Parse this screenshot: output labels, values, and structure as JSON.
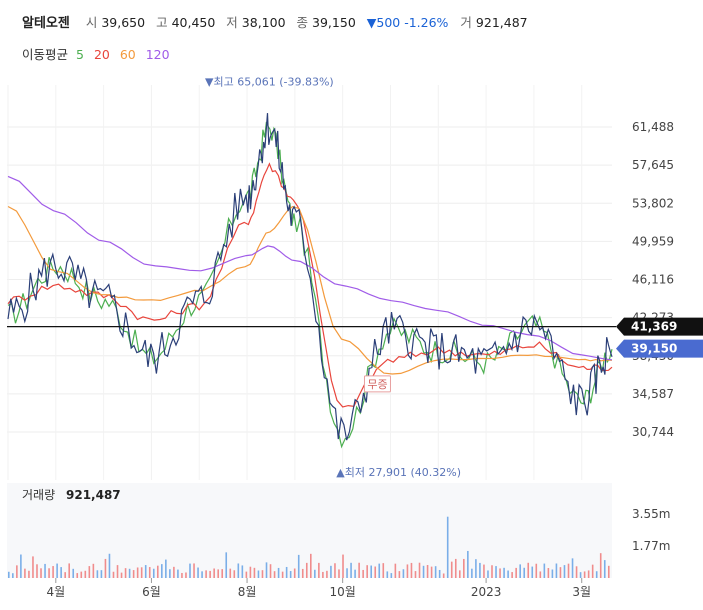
{
  "header": {
    "name": "알테오젠",
    "open_label": "시",
    "open": "39,650",
    "high_label": "고",
    "high": "40,450",
    "low_label": "저",
    "low": "38,100",
    "close_label": "종",
    "close": "39,150",
    "change_text": "▼500 -1.26%",
    "volume_label": "거",
    "volume": "921,487"
  },
  "ma_legend": {
    "title": "이동평균",
    "periods": [
      {
        "label": "5",
        "color": "#4caf50"
      },
      {
        "label": "20",
        "color": "#e8453c"
      },
      {
        "label": "60",
        "color": "#f39a3c"
      },
      {
        "label": "120",
        "color": "#a05ce8"
      }
    ]
  },
  "colors": {
    "price": "#2b3f78",
    "ma5": "#4caf50",
    "ma20": "#e8453c",
    "ma60": "#f39a3c",
    "ma120": "#a05ce8",
    "vol_up": "#f08c8c",
    "vol_down": "#7aaee8",
    "tag_current": "#4a6bd0",
    "tag_ref": "#111111"
  },
  "chart_data": [
    {
      "type": "line",
      "x": [
        "2022-03",
        "2022-04",
        "2022-05",
        "2022-06",
        "2022-07",
        "2022-08",
        "2022-08-15",
        "2022-09",
        "2022-10",
        "2022-11",
        "2022-12",
        "2023-01",
        "2023-02",
        "2023-03",
        "2023-03-20"
      ],
      "series": [
        {
          "name": "5",
          "values": [
            42500,
            47500,
            44000,
            38200,
            44000,
            54500,
            61500,
            52000,
            30500,
            41000,
            39000,
            37800,
            41500,
            33800,
            39150
          ]
        },
        {
          "name": "20",
          "values": [
            44000,
            45500,
            44500,
            42000,
            43500,
            52000,
            57500,
            54000,
            33000,
            38000,
            39000,
            38500,
            39500,
            37200,
            37300
          ]
        },
        {
          "name": "60",
          "values": [
            53500,
            47000,
            44500,
            44000,
            45000,
            47500,
            51000,
            53500,
            40000,
            36500,
            38000,
            38200,
            38500,
            38000,
            38000
          ]
        },
        {
          "name": "120",
          "values": [
            56500,
            53000,
            50000,
            47500,
            47000,
            48500,
            49500,
            48000,
            45500,
            44000,
            43000,
            41500,
            40500,
            38500,
            38000
          ]
        }
      ],
      "y_ticks": [
        "61,488",
        "57,645",
        "53,802",
        "49,959",
        "46,116",
        "42,273",
        "38,430",
        "34,587",
        "30,744"
      ],
      "ylim": [
        27901,
        65061
      ],
      "annotations": {
        "high": "▼최고 65,061 (-39.83%)",
        "low": "▲최저 27,901 (40.32%)",
        "marker": "무증",
        "reference_price": "41,369",
        "current_price": "39,150"
      }
    },
    {
      "type": "bar",
      "title": "거래량",
      "value": "921,487",
      "y_ticks": [
        "3.55m",
        "1.77m"
      ],
      "x_ticks": [
        "4월",
        "6월",
        "8월",
        "10월",
        "2023",
        "3월"
      ]
    }
  ]
}
